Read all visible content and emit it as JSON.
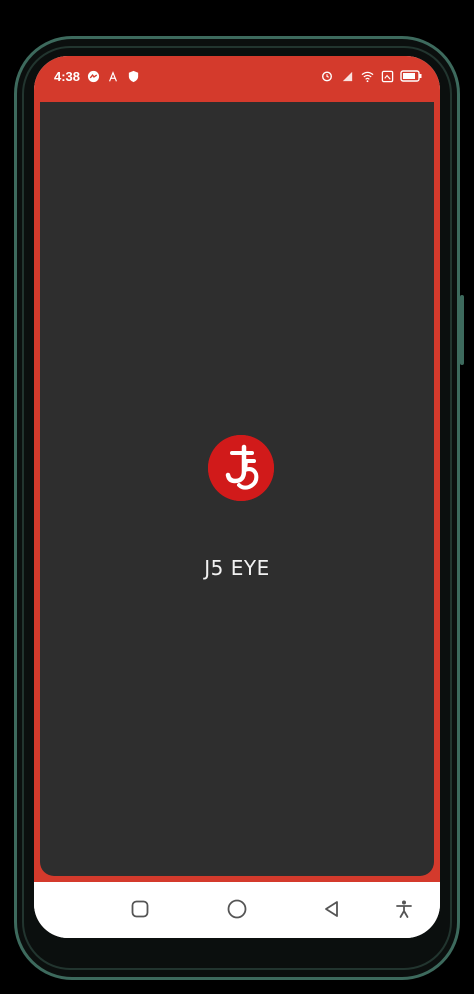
{
  "status_bar": {
    "time": "4:38",
    "left_icons": [
      "messenger-icon",
      "notification-a-icon",
      "shield-icon"
    ],
    "right_icons": [
      "alarm-icon",
      "signal-icon",
      "wifi-icon",
      "screenshot-icon",
      "battery-icon"
    ],
    "color": "#d43a2c"
  },
  "app": {
    "logo": "js5-logo",
    "title": "J5 EYE",
    "background": "#2e2e2e",
    "accent": "#d11a1a"
  },
  "nav_bar": {
    "buttons": [
      "recent-apps-button",
      "home-button",
      "back-button",
      "accessibility-button"
    ]
  }
}
